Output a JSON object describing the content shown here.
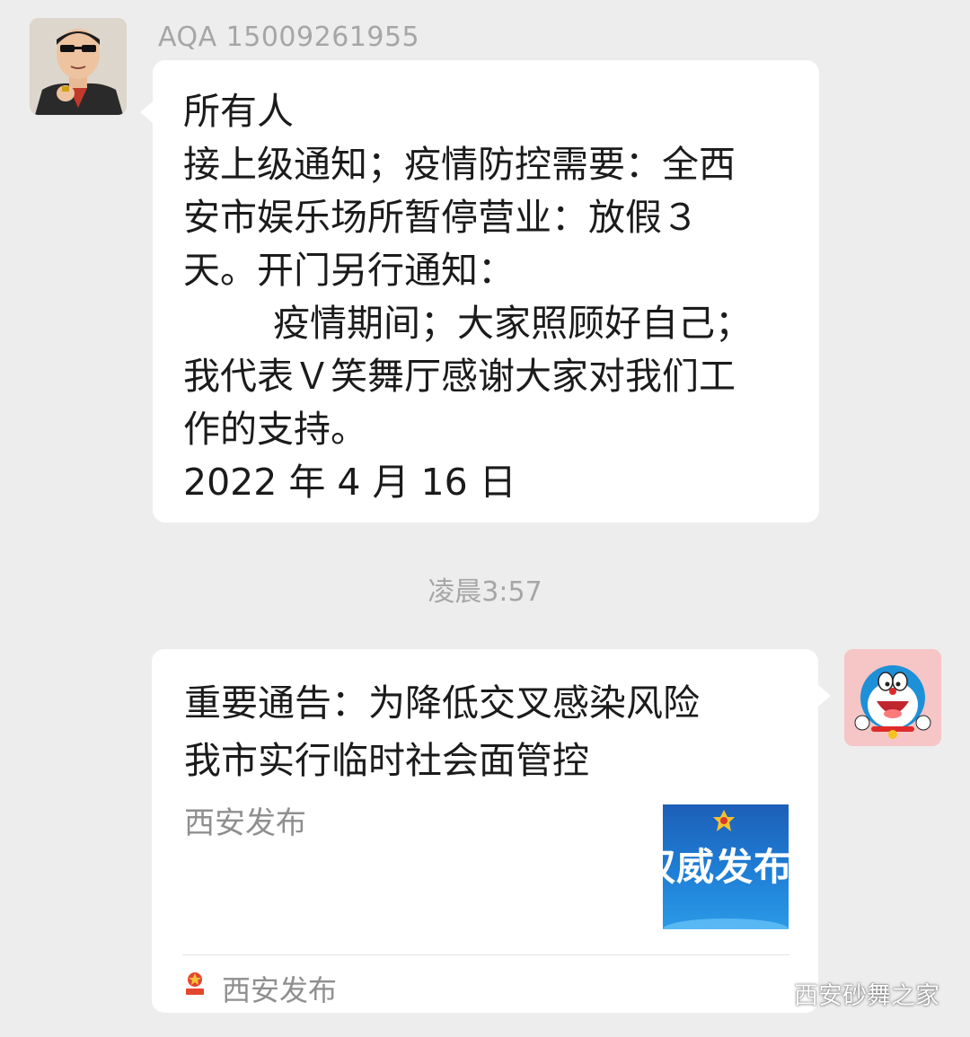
{
  "incoming": {
    "sender_name": "AQA 15009261955",
    "lines": [
      "所有人",
      "接上级通知；疫情防控需要：全西",
      "安市娱乐场所暂停营业：放假３",
      "天。开门另行通知：",
      "疫情期间；大家照顾好自己；",
      "我代表Ｖ笑舞厅感谢大家对我们工",
      "作的支持。",
      "2022 年 4 月 16 日"
    ]
  },
  "timestamp": "凌晨3:57",
  "article_card": {
    "title_lines": [
      "重要通告：为降低交叉感染风险",
      "我市实行临时社会面管控"
    ],
    "source": "西安发布",
    "thumbnail_text": "权威发布",
    "footer_account": "西安发布"
  },
  "watermark": {
    "text": "西安砂舞之家"
  },
  "colors": {
    "background": "#ededed",
    "bubble": "#ffffff",
    "meta_text": "#a6a6a6",
    "thumb_blue": "#1f7fd6"
  },
  "icons": {
    "sender_avatar": "avatar-cartoon-man",
    "self_avatar": "avatar-doraemon",
    "watermark_icon": "wechat-official-account-icon",
    "card_footer_icon": "xian-fabu-logo-icon"
  }
}
